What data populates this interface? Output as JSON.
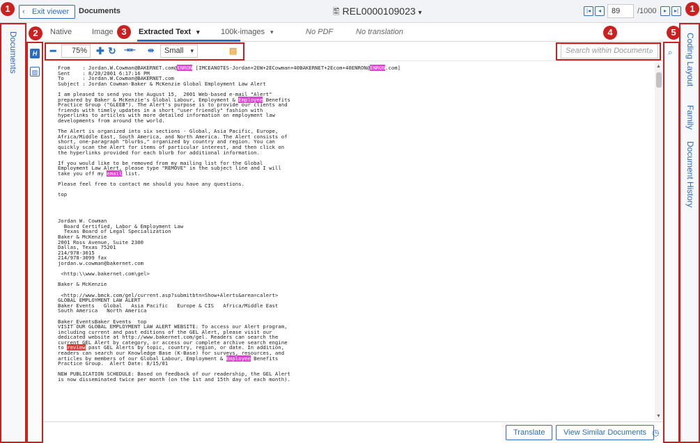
{
  "topbar": {
    "exit_label": "Exit viewer",
    "title": "Documents",
    "doc_id": "REL0000109023",
    "page_current": "89",
    "page_total": "/1000"
  },
  "left_rail": {
    "label": "Documents"
  },
  "tabs": [
    {
      "label": "Native"
    },
    {
      "label": "Image"
    },
    {
      "label": "Extracted Text"
    },
    {
      "label": "100k-images"
    },
    {
      "label": "No PDF"
    },
    {
      "label": "No translation"
    }
  ],
  "toolbar": {
    "zoom": "75%",
    "font_size": "Small",
    "search_placeholder": "Search within Document"
  },
  "document": {
    "lines": [
      "From    : Jordan.W.Cowman@BAKERNET.com@ENRON [IMCEANOTES-Jordan+2EW+2ECowman+40BAKERNET+2Ecom+40ENRON@ENRON.com]",
      "Sent    : 8/20/2001 6:17:16 PM",
      "To      : Jordan.W.Cowman@BAKERNET.com",
      "Subject : Jordan Cowman-Baker & McKenzie Global Employment Law Alert",
      "",
      "I am pleased to send you the August 15,  2001 Web-based e-mail \"Alert\"",
      "prepared by Baker & McKenzie's Global Labour, Employment & Employee Benefits",
      "Practice Group (\"GLEEB\"). The Alert's purpose is to provide our clients and",
      "friends with timely updates in a short \"user friendly\" fashion with",
      "hyperlinks to articles with more detailed information on employment law",
      "developments from around the world.",
      "",
      "The Alert is organized into six sections - Global, Asia Pacific, Europe,",
      "Africa/Middle East, South America, and North America. The Alert consists of",
      "short, one-paragraph \"blurbs,\" organized by country and region. You can",
      "quickly scan the Alert for items of particular interest, and then click on",
      "the hyperlinks provided for each blurb for additional information.",
      "",
      "If you would like to be removed from my mailing list for the Global",
      "Employment Law Alert, please type \"REMOVE\" in the subject line and I will",
      "take you off my email list.",
      "",
      "Please feel free to contact me should you have any questions.",
      "",
      "top",
      "",
      "",
      "",
      "",
      "Jordan W. Cowman",
      "  Board Certified, Labor & Employment Law",
      "  Texas Board of Legal Specialization",
      "Baker & McKenzie",
      "2001 Ross Avenue, Suite 2300",
      "Dallas, Texas 75201",
      "214/978-3015",
      "214/978-3099 fax",
      "jordan.w.cowman@bakernet.com",
      "",
      " <http:\\\\www.bakernet.com\\gel>",
      "",
      "Baker & McKenzie",
      "",
      " <http://www.bmck.com/gel/current.asp?submitbtn=Show+Alerts&area=calert>",
      "GLOBAL EMPLOYMENT LAW ALERT",
      "Baker Events   Global   Asia Pacific   Europe & CIS   Africa/Middle East",
      "South America   North America",
      "",
      "Baker_EventsBaker Events  top",
      "VISIT OUR GLOBAL EMPLOYMENT LAW ALERT WEBSITE: To access our Alert program,",
      "including current and past editions of the GEL Alert, please visit our",
      "dedicated website at http://www.bakernet.com/gel. Readers can search the",
      "current GEL Alert by category, or access our complete archive search engine",
      "to review past GEL Alerts by topic, country, region, or date. In addition,",
      "readers can search our Knowledge Base (K-Base) for surveys, resources, and",
      "articles by members of our Global Labour, Employment & Employee Benefits",
      "Practice Group.  Alert Date: 8/15/01",
      "",
      "NEW PUBLICATION SCHEDULE: Based on feedback of our readership, the GEL Alert",
      "is now disseminated twice per month (on the 1st and 15th day of each month)."
    ]
  },
  "bottombar": {
    "translate_label": "Translate",
    "similar_label": "View Similar Documents"
  },
  "right_rail": {
    "tabs": [
      "Coding Layout",
      "Family",
      "Document History"
    ]
  },
  "callouts": [
    "1",
    "2",
    "3",
    "4",
    "5",
    "1"
  ],
  "colors": {
    "accent": "#2b6cc4",
    "highlight": "#e53dd8",
    "callout": "#cc1f1f"
  }
}
